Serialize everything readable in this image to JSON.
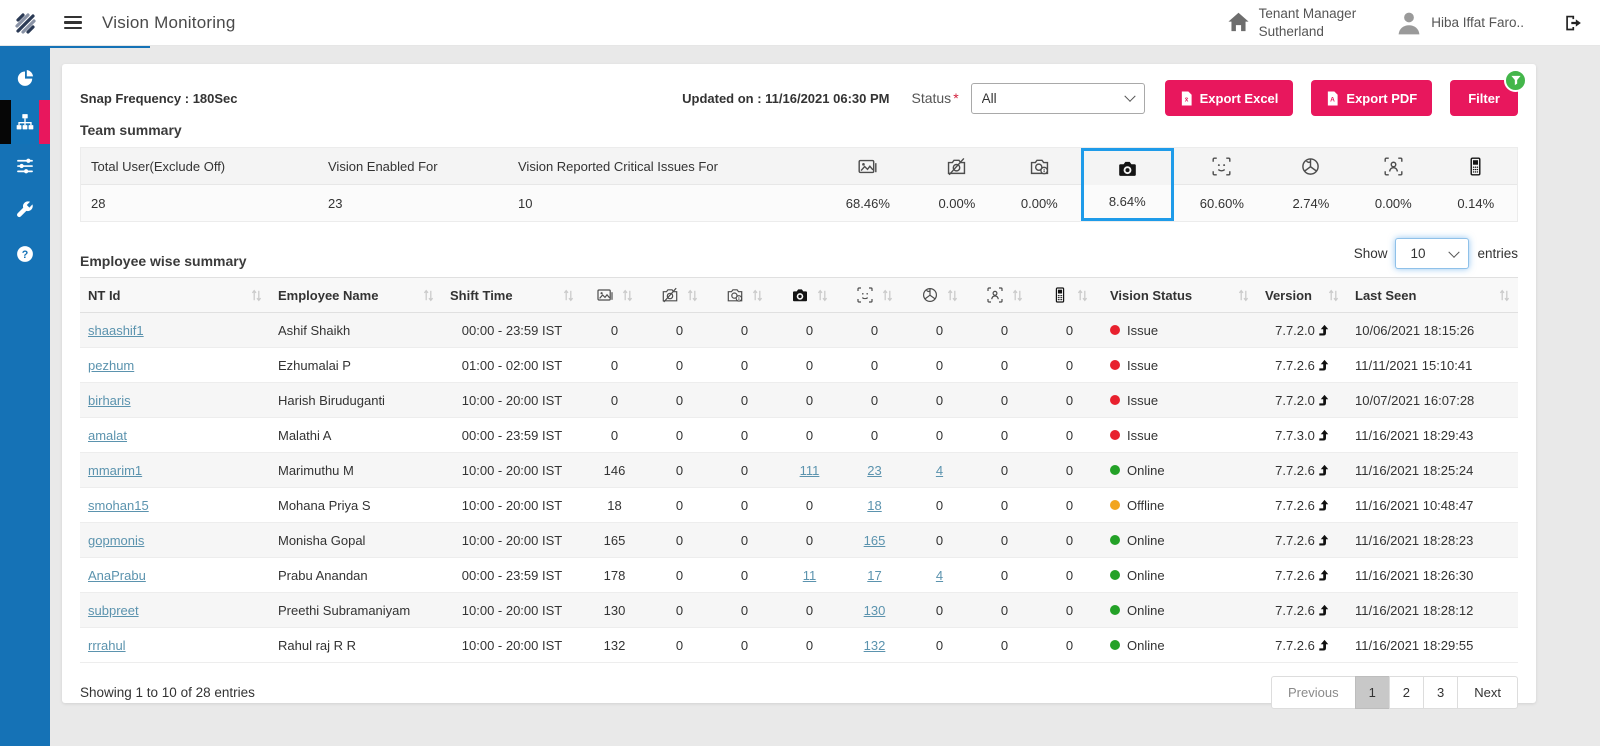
{
  "theme": {
    "accent_pink": "#e8175d",
    "sidebar_blue": "#1572b6",
    "highlight_blue": "#1e9be9",
    "link_blue": "#5b93ae",
    "status_issue_red": "#e8212e",
    "status_online_green": "#23a127",
    "status_offline_orange": "#f2a51e",
    "filter_badge_green": "#43b64a"
  },
  "header": {
    "title": "Vision Monitoring",
    "tenant_role": "Tenant Manager",
    "tenant_name": "Sutherland",
    "user_name": "Hiba Iffat Faro..",
    "icons": {
      "logo": "brand-logo",
      "menu": "menu-icon",
      "home": "home-icon",
      "user": "user-avatar-icon",
      "logout": "logout-icon"
    }
  },
  "sidebar": {
    "items": [
      {
        "icon": "pie-chart-icon",
        "active": false
      },
      {
        "icon": "sitemap-icon",
        "active": true
      },
      {
        "icon": "sliders-icon",
        "active": false
      },
      {
        "icon": "wrench-icon",
        "active": false
      },
      {
        "icon": "help-icon",
        "active": false
      }
    ]
  },
  "toolbar": {
    "snap_frequency": "Snap Frequency : 180Sec",
    "updated_on": "Updated on : 11/16/2021 06:30 PM",
    "status_label": "Status",
    "required_mark": "*",
    "status_value": "All",
    "export_excel": "Export Excel",
    "export_pdf": "Export PDF",
    "filter": "Filter"
  },
  "team_summary": {
    "title": "Team summary",
    "text_columns": [
      {
        "label": "Total User(Exclude Off)",
        "value": "28"
      },
      {
        "label": "Vision Enabled For",
        "value": "23"
      },
      {
        "label": "Vision Reported Critical Issues For",
        "value": "10"
      }
    ],
    "icon_columns": [
      {
        "icon": "image-icon",
        "value": "68.46%",
        "highlighted": false
      },
      {
        "icon": "camera-off-icon",
        "value": "0.00%",
        "highlighted": false
      },
      {
        "icon": "camera-timer-icon",
        "value": "0.00%",
        "highlighted": false
      },
      {
        "icon": "camera-solid-icon",
        "value": "8.64%",
        "highlighted": true
      },
      {
        "icon": "face-scan-icon",
        "value": "60.60%",
        "highlighted": false
      },
      {
        "icon": "face-covered-icon",
        "value": "2.74%",
        "highlighted": false
      },
      {
        "icon": "person-scan-icon",
        "value": "0.00%",
        "highlighted": false
      },
      {
        "icon": "mobile-icon",
        "value": "0.14%",
        "highlighted": false
      }
    ]
  },
  "employee_summary": {
    "title": "Employee wise summary",
    "show_label": "Show",
    "page_size": "10",
    "entries_label": "entries",
    "text_headers": [
      "NT Id",
      "Employee Name",
      "Shift Time"
    ],
    "icon_headers": [
      "image-icon",
      "camera-off-icon",
      "camera-timer-icon",
      "camera-solid-icon",
      "face-scan-icon",
      "face-covered-icon",
      "person-scan-icon",
      "mobile-icon"
    ],
    "tail_headers": [
      "Vision Status",
      "Version",
      "Last Seen"
    ],
    "rows": [
      {
        "nt_id": "shaashif1",
        "employee_name": "Ashif Shaikh",
        "shift_time": "00:00 - 23:59 IST",
        "counts": [
          {
            "v": "0"
          },
          {
            "v": "0"
          },
          {
            "v": "0"
          },
          {
            "v": "0"
          },
          {
            "v": "0"
          },
          {
            "v": "0"
          },
          {
            "v": "0"
          },
          {
            "v": "0"
          }
        ],
        "status": "Issue",
        "version": "7.7.2.0",
        "last_seen": "10/06/2021 18:15:26"
      },
      {
        "nt_id": "pezhum",
        "employee_name": "Ezhumalai P",
        "shift_time": "01:00 - 02:00 IST",
        "counts": [
          {
            "v": "0"
          },
          {
            "v": "0"
          },
          {
            "v": "0"
          },
          {
            "v": "0"
          },
          {
            "v": "0"
          },
          {
            "v": "0"
          },
          {
            "v": "0"
          },
          {
            "v": "0"
          }
        ],
        "status": "Issue",
        "version": "7.7.2.6",
        "last_seen": "11/11/2021 15:10:41"
      },
      {
        "nt_id": "birharis",
        "employee_name": "Harish Biruduganti",
        "shift_time": "10:00 - 20:00 IST",
        "counts": [
          {
            "v": "0"
          },
          {
            "v": "0"
          },
          {
            "v": "0"
          },
          {
            "v": "0"
          },
          {
            "v": "0"
          },
          {
            "v": "0"
          },
          {
            "v": "0"
          },
          {
            "v": "0"
          }
        ],
        "status": "Issue",
        "version": "7.7.2.0",
        "last_seen": "10/07/2021 16:07:28"
      },
      {
        "nt_id": "amalat",
        "employee_name": "Malathi A",
        "shift_time": "00:00 - 23:59 IST",
        "counts": [
          {
            "v": "0"
          },
          {
            "v": "0"
          },
          {
            "v": "0"
          },
          {
            "v": "0"
          },
          {
            "v": "0"
          },
          {
            "v": "0"
          },
          {
            "v": "0"
          },
          {
            "v": "0"
          }
        ],
        "status": "Issue",
        "version": "7.7.3.0",
        "last_seen": "11/16/2021 18:29:43"
      },
      {
        "nt_id": "mmarim1",
        "employee_name": "Marimuthu M",
        "shift_time": "10:00 - 20:00 IST",
        "counts": [
          {
            "v": "146"
          },
          {
            "v": "0"
          },
          {
            "v": "0"
          },
          {
            "v": "111",
            "link": true
          },
          {
            "v": "23",
            "link": true
          },
          {
            "v": "4",
            "link": true
          },
          {
            "v": "0"
          },
          {
            "v": "0"
          }
        ],
        "status": "Online",
        "version": "7.7.2.6",
        "last_seen": "11/16/2021 18:25:24"
      },
      {
        "nt_id": "smohan15",
        "employee_name": "Mohana Priya S",
        "shift_time": "10:00 - 20:00 IST",
        "counts": [
          {
            "v": "18"
          },
          {
            "v": "0"
          },
          {
            "v": "0"
          },
          {
            "v": "0"
          },
          {
            "v": "18",
            "link": true
          },
          {
            "v": "0"
          },
          {
            "v": "0"
          },
          {
            "v": "0"
          }
        ],
        "status": "Offline",
        "version": "7.7.2.6",
        "last_seen": "11/16/2021 10:48:47"
      },
      {
        "nt_id": "gopmonis",
        "employee_name": "Monisha Gopal",
        "shift_time": "10:00 - 20:00 IST",
        "counts": [
          {
            "v": "165"
          },
          {
            "v": "0"
          },
          {
            "v": "0"
          },
          {
            "v": "0"
          },
          {
            "v": "165",
            "link": true
          },
          {
            "v": "0"
          },
          {
            "v": "0"
          },
          {
            "v": "0"
          }
        ],
        "status": "Online",
        "version": "7.7.2.6",
        "last_seen": "11/16/2021 18:28:23"
      },
      {
        "nt_id": "AnaPrabu",
        "employee_name": "Prabu Anandan",
        "shift_time": "00:00 - 23:59 IST",
        "counts": [
          {
            "v": "178"
          },
          {
            "v": "0"
          },
          {
            "v": "0"
          },
          {
            "v": "11",
            "link": true
          },
          {
            "v": "17",
            "link": true
          },
          {
            "v": "4",
            "link": true
          },
          {
            "v": "0"
          },
          {
            "v": "0"
          }
        ],
        "status": "Online",
        "version": "7.7.2.6",
        "last_seen": "11/16/2021 18:26:30"
      },
      {
        "nt_id": "subpreet",
        "employee_name": "Preethi Subramaniyam",
        "shift_time": "10:00 - 20:00 IST",
        "counts": [
          {
            "v": "130"
          },
          {
            "v": "0"
          },
          {
            "v": "0"
          },
          {
            "v": "0"
          },
          {
            "v": "130",
            "link": true
          },
          {
            "v": "0"
          },
          {
            "v": "0"
          },
          {
            "v": "0"
          }
        ],
        "status": "Online",
        "version": "7.7.2.6",
        "last_seen": "11/16/2021 18:28:12"
      },
      {
        "nt_id": "rrrahul",
        "employee_name": "Rahul raj R R",
        "shift_time": "10:00 - 20:00 IST",
        "counts": [
          {
            "v": "132"
          },
          {
            "v": "0"
          },
          {
            "v": "0"
          },
          {
            "v": "0"
          },
          {
            "v": "132",
            "link": true
          },
          {
            "v": "0"
          },
          {
            "v": "0"
          },
          {
            "v": "0"
          }
        ],
        "status": "Online",
        "version": "7.7.2.6",
        "last_seen": "11/16/2021 18:29:55"
      }
    ],
    "footer": {
      "showing_text": "Showing 1 to 10 of 28 entries",
      "previous_label": "Previous",
      "pages": [
        "1",
        "2",
        "3"
      ],
      "active_page": "1",
      "next_label": "Next"
    }
  }
}
